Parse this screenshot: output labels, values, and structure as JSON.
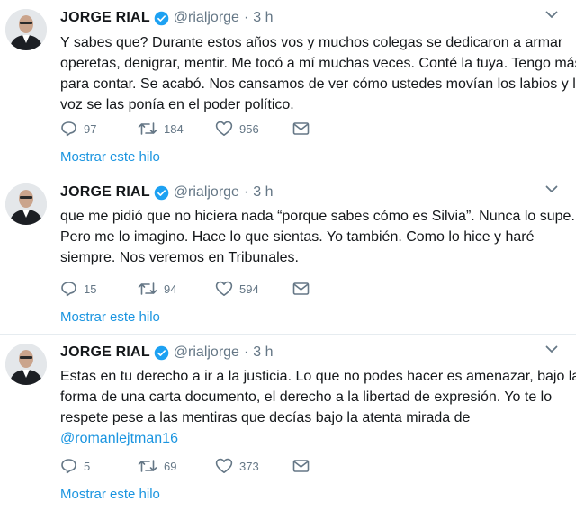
{
  "tweets": [
    {
      "author": "JORGE RIAL",
      "handle": "@rialjorge",
      "separator": "·",
      "time": "3 h",
      "lines": [
        "Y sabes que? Durante estos años vos y muchos colegas se dedicaron a armar",
        "operetas, denigrar, mentir. Me tocó a mí muchas veces. Conté la tuya. Tengo más",
        "para contar. Se acabó. Nos cansamos de ver cómo ustedes movían los labios y la",
        "voz se las ponía en el poder político."
      ],
      "replies": "97",
      "retweets": "184",
      "likes": "956",
      "show_thread": "Mostrar este hilo"
    },
    {
      "author": "JORGE RIAL",
      "handle": "@rialjorge",
      "separator": "·",
      "time": "3 h",
      "lines": [
        "que me pidió que no hiciera nada “porque sabes cómo es Silvia”. Nunca lo supe.",
        "Pero me lo imagino. Hace lo que sientas. Yo también. Como lo hice y haré",
        "siempre. Nos veremos en Tribunales."
      ],
      "replies": "15",
      "retweets": "94",
      "likes": "594",
      "show_thread": "Mostrar este hilo"
    },
    {
      "author": "JORGE RIAL",
      "handle": "@rialjorge",
      "separator": "·",
      "time": "3 h",
      "lines": [
        "Estas en tu derecho a ir a la justicia. Lo que no podes hacer es amenazar, bajo la",
        "forma de una carta documento, el derecho a la libertad de expresión. Yo te lo",
        "respete pese a las mentiras que decías bajo la atenta mirada de"
      ],
      "mention": "@romanlejtman16",
      "replies": "5",
      "retweets": "69",
      "likes": "373",
      "show_thread": "Mostrar este hilo"
    }
  ],
  "icons": {
    "reply": "reply-icon",
    "retweet": "retweet-icon",
    "like": "like-icon",
    "dm": "direct-message-icon",
    "verified": "verified-badge-icon",
    "caret": "chevron-down-icon"
  },
  "colors": {
    "name": "#14171a",
    "secondary": "#657786",
    "link": "#1b95e0",
    "verified": "#1da1f2",
    "divider": "#e6ecf0"
  }
}
